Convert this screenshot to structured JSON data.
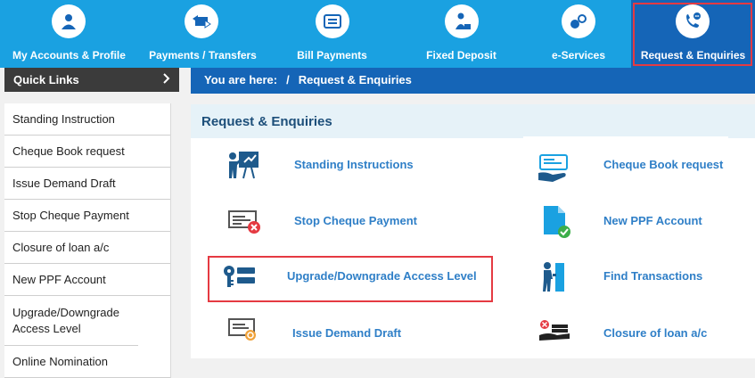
{
  "nav": {
    "items": [
      {
        "label": "My Accounts & Profile",
        "icon": "user-icon"
      },
      {
        "label": "Payments / Transfers",
        "icon": "transfer-icon"
      },
      {
        "label": "Bill Payments",
        "icon": "bill-icon"
      },
      {
        "label": "Fixed Deposit",
        "icon": "deposit-icon"
      },
      {
        "label": "e-Services",
        "icon": "eservices-icon"
      },
      {
        "label": "Request & Enquiries",
        "icon": "phone-chat-icon"
      }
    ],
    "active": "Request & Enquiries",
    "bg_color": "#1aa1e1",
    "active_color": "#1565b7"
  },
  "sidebar": {
    "title": "Quick Links",
    "items": [
      "Standing Instruction",
      "Cheque Book request",
      "Issue Demand Draft",
      "Stop Cheque Payment",
      "Closure of loan a/c",
      "New PPF Account",
      "Upgrade/Downgrade Access Level",
      "Online Nomination"
    ]
  },
  "breadcrumb": {
    "prefix": "You are here:",
    "separator": "/",
    "current": "Request & Enquiries"
  },
  "panel": {
    "title": "Request & Enquiries",
    "links": [
      {
        "label": "Standing Instructions",
        "icon": "presentation-icon"
      },
      {
        "label": "Cheque Book request",
        "icon": "cheque-book-icon"
      },
      {
        "label": "Stop Cheque Payment",
        "icon": "stop-cheque-icon"
      },
      {
        "label": "New PPF Account",
        "icon": "document-check-icon"
      },
      {
        "label": "Upgrade/Downgrade Access Level",
        "icon": "access-key-icon"
      },
      {
        "label": "Find Transactions",
        "icon": "find-transactions-icon"
      },
      {
        "label": "Issue Demand Draft",
        "icon": "demand-draft-icon"
      },
      {
        "label": "Closure of loan a/c",
        "icon": "loan-closure-icon"
      }
    ]
  },
  "colors": {
    "highlight": "#e53a42",
    "link": "#2f7fc7"
  }
}
